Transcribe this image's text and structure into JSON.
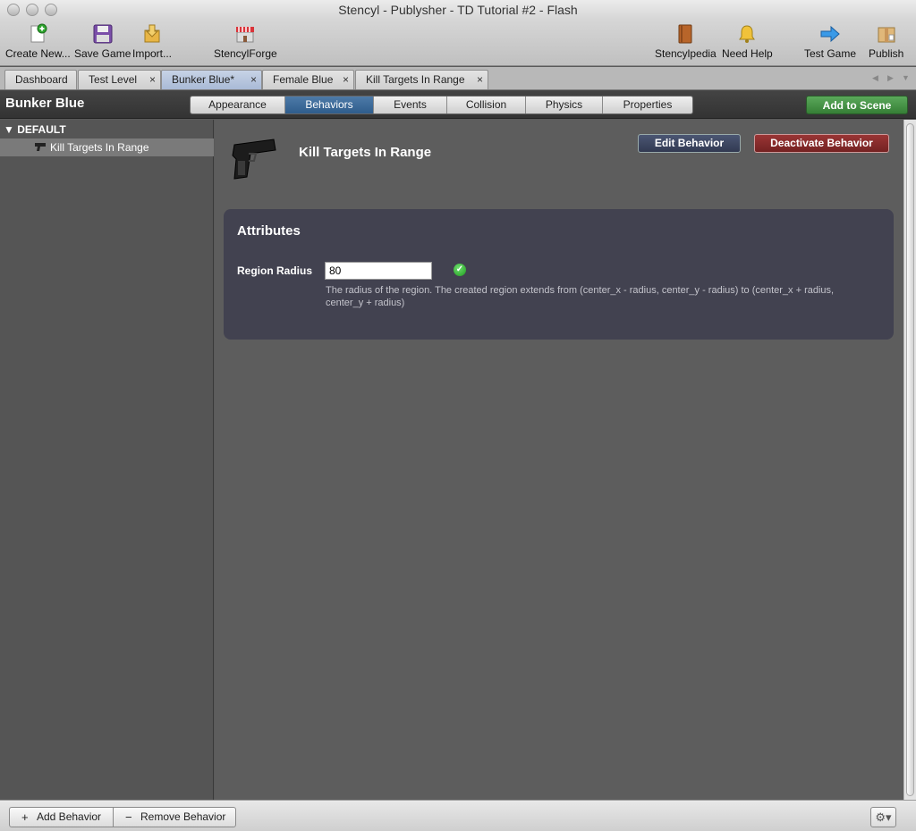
{
  "window": {
    "title": "Stencyl - Publysher - TD Tutorial #2 - Flash"
  },
  "toolbar": {
    "create_new": "Create New...",
    "save_game": "Save Game",
    "import": "Import...",
    "stencylforge": "StencylForge",
    "stencylpedia": "Stencylpedia",
    "need_help": "Need Help",
    "test_game": "Test Game",
    "publish": "Publish"
  },
  "doc_tabs": [
    {
      "label": "Dashboard"
    },
    {
      "label": "Test Level",
      "close": "×"
    },
    {
      "label": "Bunker Blue*",
      "close": "×",
      "active": true
    },
    {
      "label": "Female Blue",
      "close": "×"
    },
    {
      "label": "Kill Targets In Range",
      "close": "×"
    }
  ],
  "header": {
    "actor_name": "Bunker Blue",
    "tabs": [
      "Appearance",
      "Behaviors",
      "Events",
      "Collision",
      "Physics",
      "Properties"
    ],
    "active_tab": "Behaviors",
    "add_to_scene": "Add to Scene"
  },
  "sidebar": {
    "group_label": "▼ DEFAULT",
    "items": [
      {
        "label": "Kill Targets In Range",
        "icon": "pistol-icon"
      }
    ]
  },
  "behavior": {
    "title": "Kill Targets In Range",
    "icon": "pistol-icon",
    "edit_button": "Edit Behavior",
    "deactivate_button": "Deactivate Behavior"
  },
  "attributes": {
    "heading": "Attributes",
    "region_radius": {
      "label": "Region Radius",
      "value": "80",
      "valid_icon": "check-icon",
      "description": "The radius of the region. The created region extends from (center_x - radius, center_y - radius) to (center_x + radius, center_y + radius)"
    }
  },
  "bottom": {
    "add_behavior": "Add Behavior",
    "remove_behavior": "Remove Behavior"
  },
  "colors": {
    "active_tab": "#2f5d8c",
    "add_to_scene": "#367f36",
    "deactivate": "#742222",
    "edit": "#323a52",
    "attr_panel": "#424250"
  }
}
